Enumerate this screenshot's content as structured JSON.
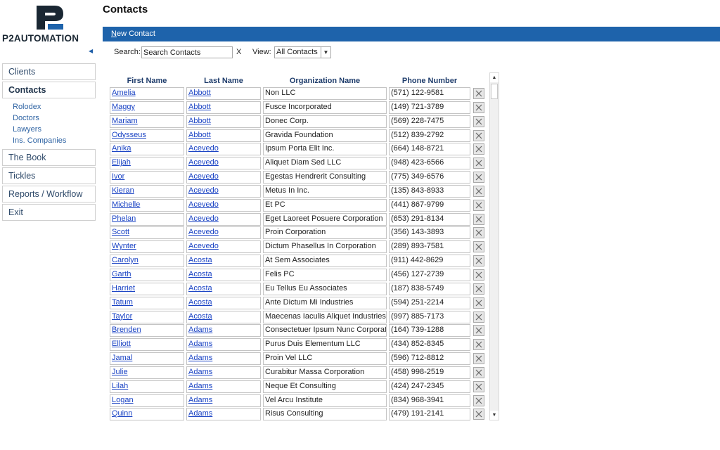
{
  "brand": {
    "logo_mark": "P2",
    "name": "P2AUTOMATION"
  },
  "colors": {
    "accent": "#1e63ab",
    "link": "#1a43c4",
    "nav_text": "#2f4a6a"
  },
  "sidebar": {
    "collapse_icon": "triangle-left-icon",
    "items": [
      {
        "label": "Clients",
        "active": false
      },
      {
        "label": "Contacts",
        "active": true
      },
      {
        "label": "The Book",
        "active": false
      },
      {
        "label": "Tickles",
        "active": false
      },
      {
        "label": "Reports / Workflow",
        "active": false
      },
      {
        "label": "Exit",
        "active": false
      }
    ],
    "sub_items": [
      "Rolodex",
      "Doctors",
      "Lawyers",
      "Ins. Companies"
    ]
  },
  "header": {
    "title": "Contacts"
  },
  "toolbar": {
    "new_contact_first": "N",
    "new_contact_rest": "ew Contact"
  },
  "search": {
    "label": "Search:",
    "value": "Search Contacts",
    "clear": "X"
  },
  "view": {
    "label": "View:",
    "selected": "All Contacts"
  },
  "table": {
    "columns": [
      "First Name",
      "Last Name",
      "Organization Name",
      "Phone Number"
    ],
    "delete_icon": "close-x-icon",
    "rows": [
      [
        "Amelia",
        "Abbott",
        "Non LLC",
        "(571) 122-9581"
      ],
      [
        "Maggy",
        "Abbott",
        "Fusce Incorporated",
        "(149) 721-3789"
      ],
      [
        "Mariam",
        "Abbott",
        "Donec Corp.",
        "(569) 228-7475"
      ],
      [
        "Odysseus",
        "Abbott",
        "Gravida Foundation",
        "(512) 839-2792"
      ],
      [
        "Anika",
        "Acevedo",
        "Ipsum Porta Elit Inc.",
        "(664) 148-8721"
      ],
      [
        "Elijah",
        "Acevedo",
        "Aliquet Diam Sed LLC",
        "(948) 423-6566"
      ],
      [
        "Ivor",
        "Acevedo",
        "Egestas Hendrerit Consulting",
        "(775) 349-6576"
      ],
      [
        "Kieran",
        "Acevedo",
        "Metus In Inc.",
        "(135) 843-8933"
      ],
      [
        "Michelle",
        "Acevedo",
        "Et PC",
        "(441) 867-9799"
      ],
      [
        "Phelan",
        "Acevedo",
        "Eget Laoreet Posuere Corporation",
        "(653) 291-8134"
      ],
      [
        "Scott",
        "Acevedo",
        "Proin Corporation",
        "(356) 143-3893"
      ],
      [
        "Wynter",
        "Acevedo",
        "Dictum Phasellus In Corporation",
        "(289) 893-7581"
      ],
      [
        "Carolyn",
        "Acosta",
        "At Sem Associates",
        "(911) 442-8629"
      ],
      [
        "Garth",
        "Acosta",
        "Felis PC",
        "(456) 127-2739"
      ],
      [
        "Harriet",
        "Acosta",
        "Eu Tellus Eu Associates",
        "(187) 838-5749"
      ],
      [
        "Tatum",
        "Acosta",
        "Ante Dictum Mi Industries",
        "(594) 251-2214"
      ],
      [
        "Taylor",
        "Acosta",
        "Maecenas Iaculis Aliquet Industries",
        "(997) 885-7173"
      ],
      [
        "Brenden",
        "Adams",
        "Consectetuer Ipsum Nunc Corporati",
        "(164) 739-1288"
      ],
      [
        "Elliott",
        "Adams",
        "Purus Duis Elementum LLC",
        "(434) 852-8345"
      ],
      [
        "Jamal",
        "Adams",
        "Proin Vel LLC",
        "(596) 712-8812"
      ],
      [
        "Julie",
        "Adams",
        "Curabitur Massa Corporation",
        "(458) 998-2519"
      ],
      [
        "Lilah",
        "Adams",
        "Neque Et Consulting",
        "(424) 247-2345"
      ],
      [
        "Logan",
        "Adams",
        "Vel Arcu Institute",
        "(834) 968-3941"
      ],
      [
        "Quinn",
        "Adams",
        "Risus Consulting",
        "(479) 191-2141"
      ]
    ]
  },
  "scrollbar": {
    "up_icon": "scroll-up-arrow-icon",
    "down_icon": "scroll-down-arrow-icon"
  }
}
